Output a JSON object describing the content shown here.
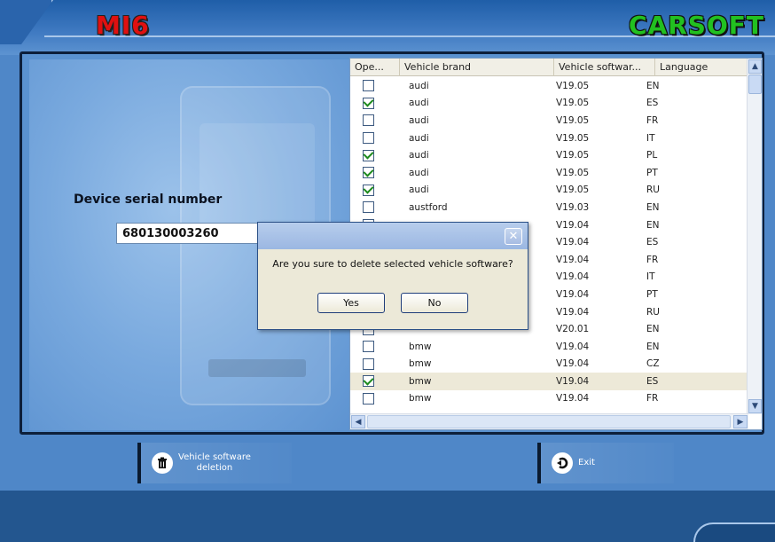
{
  "app": {
    "logo_left": "MI6",
    "logo_right": "CARSOFT"
  },
  "serial": {
    "label": "Device serial number",
    "value": "680130003260"
  },
  "table": {
    "columns": [
      "Ope...",
      "Vehicle brand",
      "Vehicle softwar...",
      "Language"
    ],
    "rows": [
      {
        "checked": false,
        "brand": "audi",
        "version": "V19.05",
        "language": "EN",
        "selected": false
      },
      {
        "checked": true,
        "brand": "audi",
        "version": "V19.05",
        "language": "ES",
        "selected": false
      },
      {
        "checked": false,
        "brand": "audi",
        "version": "V19.05",
        "language": "FR",
        "selected": false
      },
      {
        "checked": false,
        "brand": "audi",
        "version": "V19.05",
        "language": "IT",
        "selected": false
      },
      {
        "checked": true,
        "brand": "audi",
        "version": "V19.05",
        "language": "PL",
        "selected": false
      },
      {
        "checked": true,
        "brand": "audi",
        "version": "V19.05",
        "language": "PT",
        "selected": false
      },
      {
        "checked": true,
        "brand": "audi",
        "version": "V19.05",
        "language": "RU",
        "selected": false
      },
      {
        "checked": false,
        "brand": "austford",
        "version": "V19.03",
        "language": "EN",
        "selected": false
      },
      {
        "checked": false,
        "brand": "",
        "version": "V19.04",
        "language": "EN",
        "selected": false
      },
      {
        "checked": false,
        "brand": "",
        "version": "V19.04",
        "language": "ES",
        "selected": false
      },
      {
        "checked": false,
        "brand": "",
        "version": "V19.04",
        "language": "FR",
        "selected": false
      },
      {
        "checked": false,
        "brand": "",
        "version": "V19.04",
        "language": "IT",
        "selected": false
      },
      {
        "checked": false,
        "brand": "",
        "version": "V19.04",
        "language": "PT",
        "selected": false
      },
      {
        "checked": false,
        "brand": "",
        "version": "V19.04",
        "language": "RU",
        "selected": false
      },
      {
        "checked": false,
        "brand": "",
        "version": "V20.01",
        "language": "EN",
        "selected": false
      },
      {
        "checked": false,
        "brand": "bmw",
        "version": "V19.04",
        "language": "EN",
        "selected": false
      },
      {
        "checked": false,
        "brand": "bmw",
        "version": "V19.04",
        "language": "CZ",
        "selected": false
      },
      {
        "checked": true,
        "brand": "bmw",
        "version": "V19.04",
        "language": "ES",
        "selected": true
      },
      {
        "checked": false,
        "brand": "bmw",
        "version": "V19.04",
        "language": "FR",
        "selected": false
      }
    ]
  },
  "dialog": {
    "message": "Are you sure to delete selected vehicle software?",
    "yes_label": "Yes",
    "no_label": "No",
    "close_glyph": "✕"
  },
  "toolbar": {
    "delete_label_line1": "Vehicle software",
    "delete_label_line2": "deletion",
    "delete_icon": "trash-icon",
    "exit_label": "Exit",
    "exit_icon": "exit-icon"
  }
}
